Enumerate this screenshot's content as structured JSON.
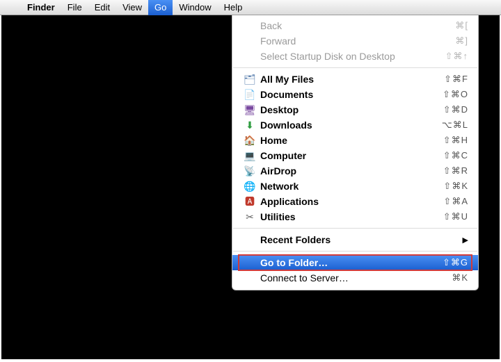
{
  "menubar": {
    "app": "Finder",
    "items": [
      "File",
      "Edit",
      "View",
      "Go",
      "Window",
      "Help"
    ],
    "active_index": 3
  },
  "go_menu": {
    "nav": [
      {
        "label": "Back",
        "shortcut": "⌘[",
        "enabled": false
      },
      {
        "label": "Forward",
        "shortcut": "⌘]",
        "enabled": false
      },
      {
        "label": "Select Startup Disk on Desktop",
        "shortcut": "⇧⌘↑",
        "enabled": false
      }
    ],
    "places": [
      {
        "icon": "allfiles-icon",
        "label": "All My Files",
        "shortcut": "⇧⌘F"
      },
      {
        "icon": "documents-icon",
        "label": "Documents",
        "shortcut": "⇧⌘O"
      },
      {
        "icon": "desktop-icon",
        "label": "Desktop",
        "shortcut": "⇧⌘D"
      },
      {
        "icon": "downloads-icon",
        "label": "Downloads",
        "shortcut": "⌥⌘L"
      },
      {
        "icon": "home-icon",
        "label": "Home",
        "shortcut": "⇧⌘H"
      },
      {
        "icon": "computer-icon",
        "label": "Computer",
        "shortcut": "⇧⌘C"
      },
      {
        "icon": "airdrop-icon",
        "label": "AirDrop",
        "shortcut": "⇧⌘R"
      },
      {
        "icon": "network-icon",
        "label": "Network",
        "shortcut": "⇧⌘K"
      },
      {
        "icon": "applications-icon",
        "label": "Applications",
        "shortcut": "⇧⌘A"
      },
      {
        "icon": "utilities-icon",
        "label": "Utilities",
        "shortcut": "⇧⌘U"
      }
    ],
    "recent": {
      "label": "Recent Folders"
    },
    "actions": [
      {
        "label": "Go to Folder…",
        "shortcut": "⇧⌘G",
        "highlighted": true,
        "boxed": true
      },
      {
        "label": "Connect to Server…",
        "shortcut": "⌘K"
      }
    ]
  },
  "glyphs": {
    "allfiles-icon": "🗂",
    "documents-icon": "📄",
    "desktop-icon": "🖥",
    "downloads-icon": "⬇",
    "home-icon": "🏠",
    "computer-icon": "💻",
    "airdrop-icon": "📡",
    "network-icon": "🌐",
    "applications-icon": "🅰",
    "utilities-icon": "✂"
  }
}
